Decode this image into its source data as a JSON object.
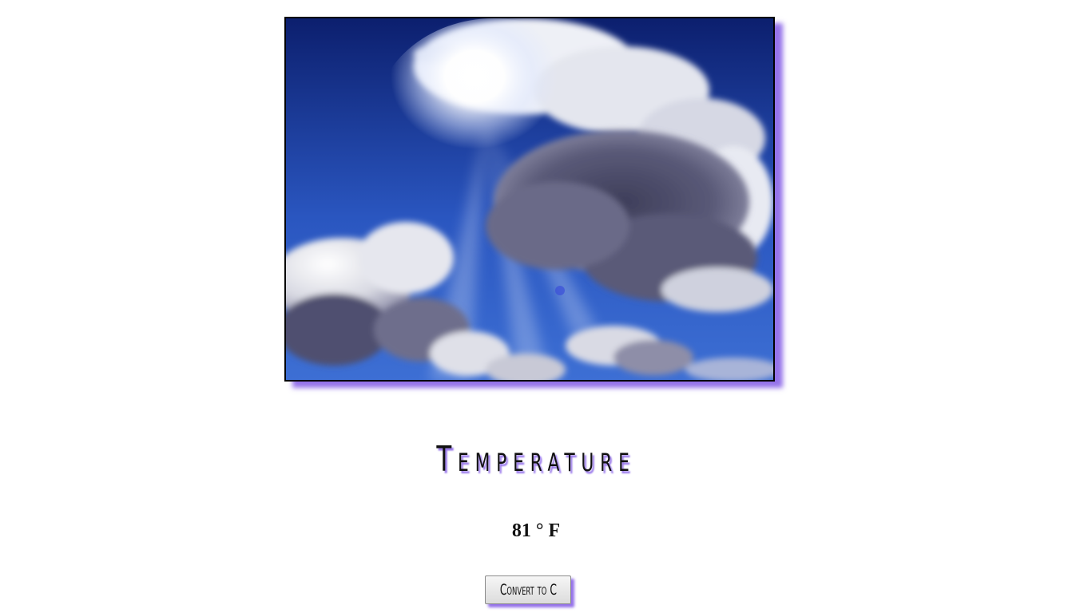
{
  "hero_image": {
    "subject": "sunlit-cloudy-sky",
    "colors": {
      "sky_dark": "#0c1f6e",
      "sky_mid": "#2a56c0",
      "cloud_light": "#f2f2f4",
      "cloud_shadow": "#4a4a66",
      "frame_shadow": "#8a5ae6"
    }
  },
  "title": "Temperature",
  "temperature": {
    "display": "81 ° F"
  },
  "convert_button": {
    "label": "Convert to C"
  }
}
